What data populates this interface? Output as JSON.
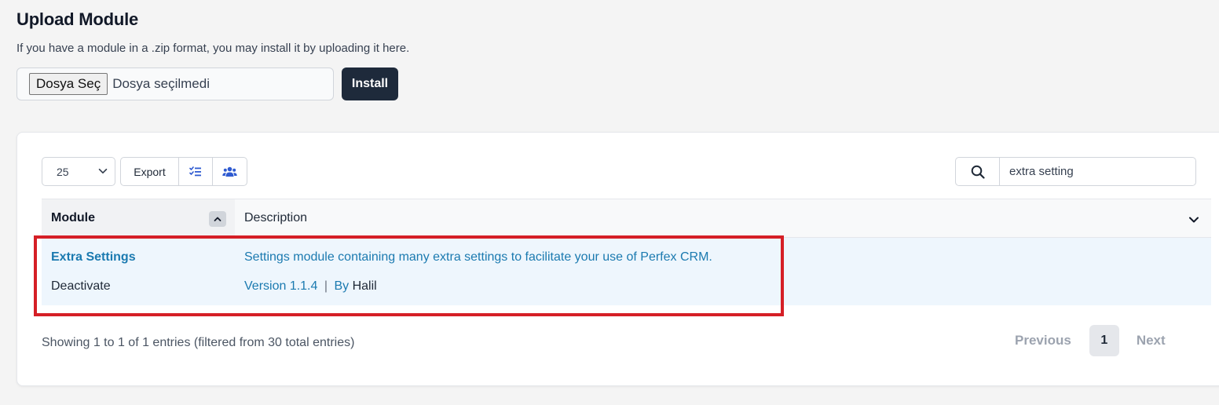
{
  "upload": {
    "title": "Upload Module",
    "hint": "If you have a module in a .zip format, you may install it by uploading it here.",
    "choose_label": "Dosya Seç",
    "file_status": "Dosya seçilmedi",
    "install_label": "Install"
  },
  "toolbar": {
    "page_length": "25",
    "export_label": "Export",
    "search_value": "extra setting"
  },
  "table": {
    "columns": [
      "Module",
      "Description"
    ],
    "rows": [
      {
        "module": "Extra Settings",
        "action": "Deactivate",
        "description": "Settings module containing many extra settings to facilitate your use of Perfex CRM.",
        "version": "Version 1.1.4",
        "separator": "|",
        "by": "By",
        "author": "Halil"
      }
    ]
  },
  "footer": {
    "info": "Showing 1 to 1 of 1 entries (filtered from 30 total entries)",
    "previous": "Previous",
    "page": "1",
    "next": "Next"
  },
  "colors": {
    "link": "#1b7ab0",
    "install_bg": "#1e2a3b",
    "row_highlight": "#eef6fd",
    "annotation_red": "#d51f26",
    "icon_blue": "#2f5bd1"
  },
  "icons": {
    "length_caret": "chevron-down-icon",
    "column_visibility": "checklist-icon",
    "group": "users-icon",
    "search": "search-icon",
    "sort": "chevron-up-icon",
    "collapse": "chevron-down-icon"
  }
}
